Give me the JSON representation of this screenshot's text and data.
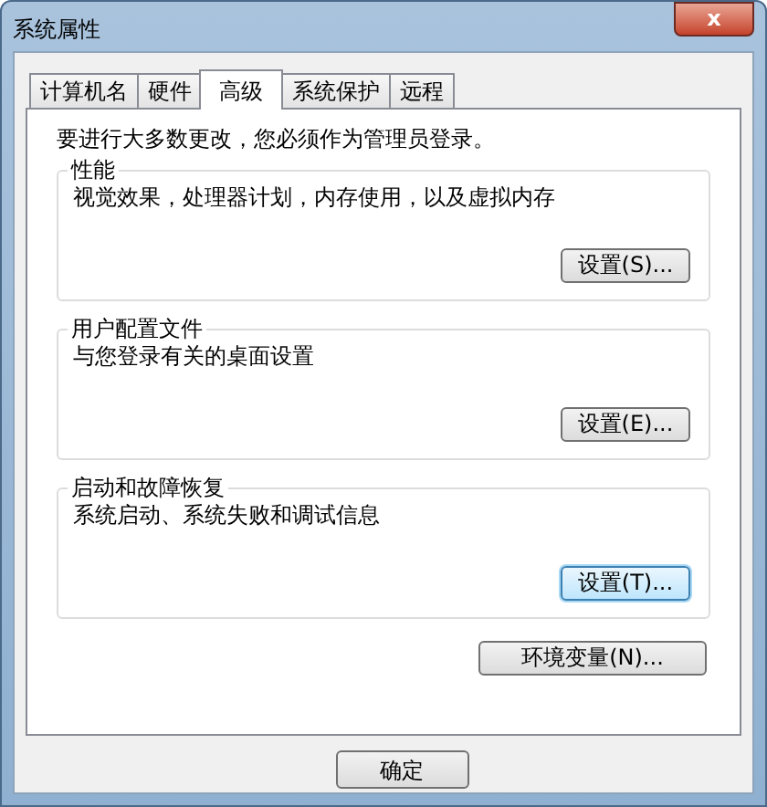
{
  "window": {
    "title": "系统属性",
    "close": "x"
  },
  "tabs": [
    {
      "label": "计算机名",
      "selected": false
    },
    {
      "label": "硬件",
      "selected": false
    },
    {
      "label": "高级",
      "selected": true
    },
    {
      "label": "系统保护",
      "selected": false
    },
    {
      "label": "远程",
      "selected": false
    }
  ],
  "notice": "要进行大多数更改，您必须作为管理员登录。",
  "groups": [
    {
      "title": "性能",
      "description": "视觉效果，处理器计划，内存使用，以及虚拟内存",
      "button": {
        "label": "设置(S)...",
        "focused": false
      }
    },
    {
      "title": "用户配置文件",
      "description": "与您登录有关的桌面设置",
      "button": {
        "label": "设置(E)...",
        "focused": false
      }
    },
    {
      "title": "启动和故障恢复",
      "description": "系统启动、系统失败和调试信息",
      "button": {
        "label": "设置(T)...",
        "focused": true
      }
    }
  ],
  "env_button": "环境变量(N)...",
  "footer_buttons": [
    "确定"
  ]
}
